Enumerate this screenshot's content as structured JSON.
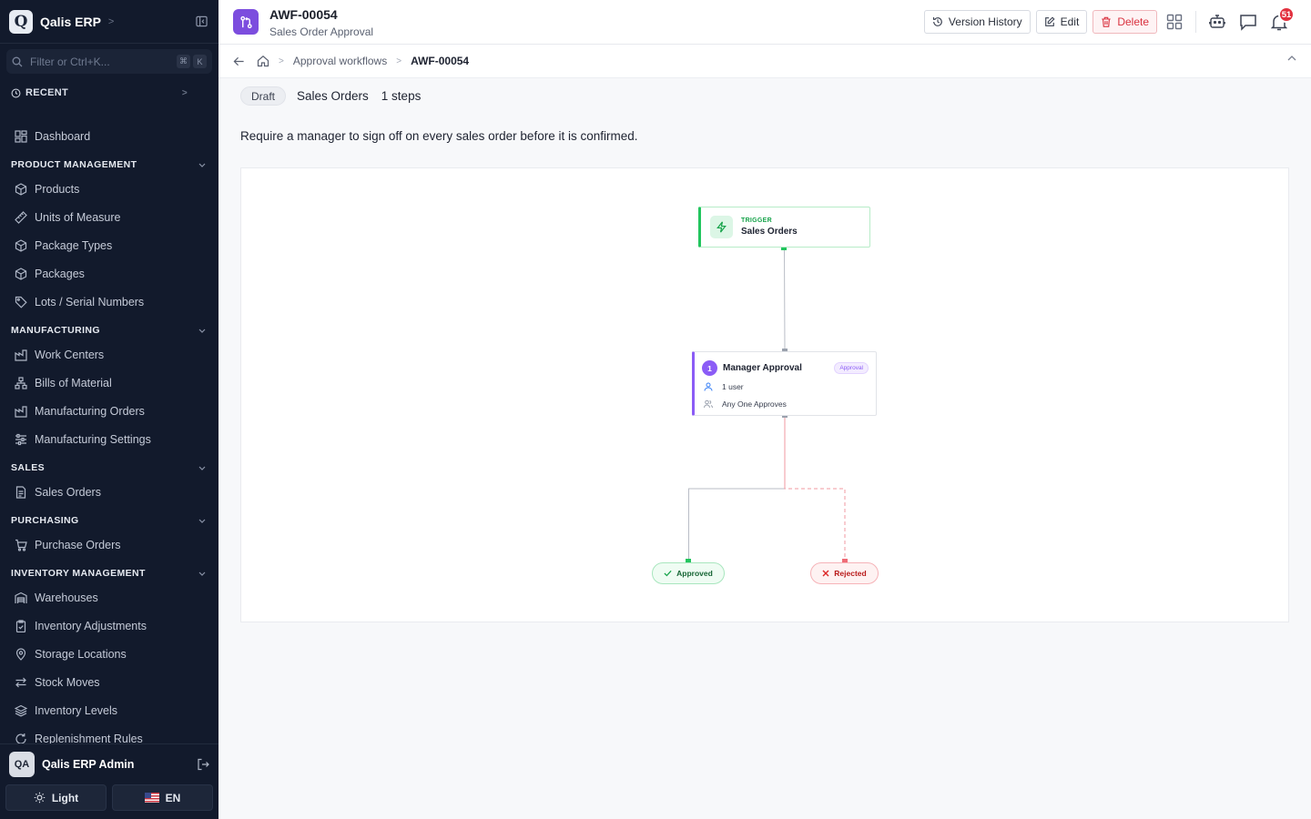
{
  "app": {
    "logo_letter": "Q",
    "name": "Qalis ERP"
  },
  "sidebar": {
    "filter_placeholder": "Filter or Ctrl+K...",
    "shortcut_keys": [
      "⌘",
      "K"
    ],
    "recent_label": "RECENT",
    "dashboard": "Dashboard",
    "sections": [
      {
        "title": "PRODUCT MANAGEMENT",
        "items": [
          "Products",
          "Units of Measure",
          "Package Types",
          "Packages",
          "Lots / Serial Numbers"
        ]
      },
      {
        "title": "MANUFACTURING",
        "items": [
          "Work Centers",
          "Bills of Material",
          "Manufacturing Orders",
          "Manufacturing Settings"
        ]
      },
      {
        "title": "SALES",
        "items": [
          "Sales Orders"
        ]
      },
      {
        "title": "PURCHASING",
        "items": [
          "Purchase Orders"
        ]
      },
      {
        "title": "INVENTORY MANAGEMENT",
        "items": [
          "Warehouses",
          "Inventory Adjustments",
          "Storage Locations",
          "Stock Moves",
          "Inventory Levels",
          "Replenishment Rules"
        ]
      }
    ],
    "user": {
      "initials": "QA",
      "name": "Qalis ERP Admin"
    },
    "theme_label": "Light",
    "language_label": "EN"
  },
  "header": {
    "title": "AWF-00054",
    "subtitle": "Sales Order Approval",
    "version_history": "Version History",
    "edit": "Edit",
    "delete": "Delete",
    "notification_count": "51"
  },
  "breadcrumb": {
    "parent": "Approval workflows",
    "current": "AWF-00054"
  },
  "workflow": {
    "status": "Draft",
    "document": "Sales Orders",
    "steps_text": "1 steps",
    "description": "Require a manager to sign off on every sales order before it is confirmed.",
    "trigger": {
      "label": "TRIGGER",
      "name": "Sales Orders"
    },
    "step": {
      "number": "1",
      "name": "Manager Approval",
      "tag": "Approval",
      "users": "1 user",
      "rule": "Any One Approves"
    },
    "approved": "Approved",
    "rejected": "Rejected"
  },
  "colors": {
    "sidebar_bg": "#121a2c",
    "accent_purple": "#8b5cf6",
    "success": "#22c55e",
    "danger": "#e2313f"
  }
}
